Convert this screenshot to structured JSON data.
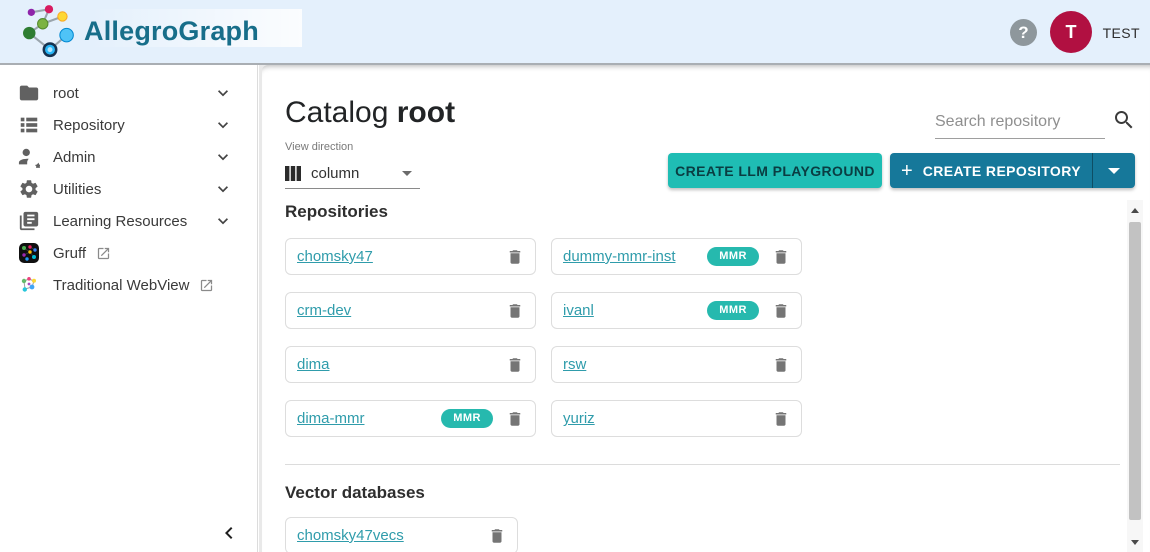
{
  "header": {
    "app_name": "AllegroGraph",
    "help_label": "?",
    "user_initial": "T",
    "user_name": "TEST"
  },
  "sidebar": {
    "items": [
      {
        "label": "root"
      },
      {
        "label": "Repository"
      },
      {
        "label": "Admin"
      },
      {
        "label": "Utilities"
      },
      {
        "label": "Learning Resources"
      },
      {
        "label": "Gruff"
      },
      {
        "label": "Traditional WebView"
      }
    ]
  },
  "main": {
    "title": {
      "prefix": "Catalog",
      "name": "root"
    },
    "search": {
      "placeholder": "Search repository"
    },
    "view_direction": {
      "label": "View direction",
      "value": "column"
    },
    "buttons": {
      "create_llm": "CREATE LLM PLAYGROUND",
      "create_repository": "CREATE REPOSITORY",
      "plus": "+"
    },
    "repositories": {
      "heading": "Repositories",
      "items": [
        {
          "name": "chomsky47"
        },
        {
          "name": "crm-dev"
        },
        {
          "name": "dima"
        },
        {
          "name": "dima-mmr",
          "badge": "MMR"
        },
        {
          "name": "dummy-mmr-inst",
          "badge": "MMR"
        },
        {
          "name": "ivanl",
          "badge": "MMR"
        },
        {
          "name": "rsw"
        },
        {
          "name": "yuriz"
        }
      ]
    },
    "vector_databases": {
      "heading": "Vector databases",
      "items": [
        {
          "name": "chomsky47vecs"
        }
      ]
    }
  },
  "colors": {
    "header_bg": "#e4f0fc",
    "logo_teal": "#176e8a",
    "accent_teal_button": "#1fbdb4",
    "accent_blue_button": "#16789a",
    "badge_teal": "#26b9ae",
    "link_teal": "#2f9cab",
    "avatar_red": "#b11041"
  }
}
